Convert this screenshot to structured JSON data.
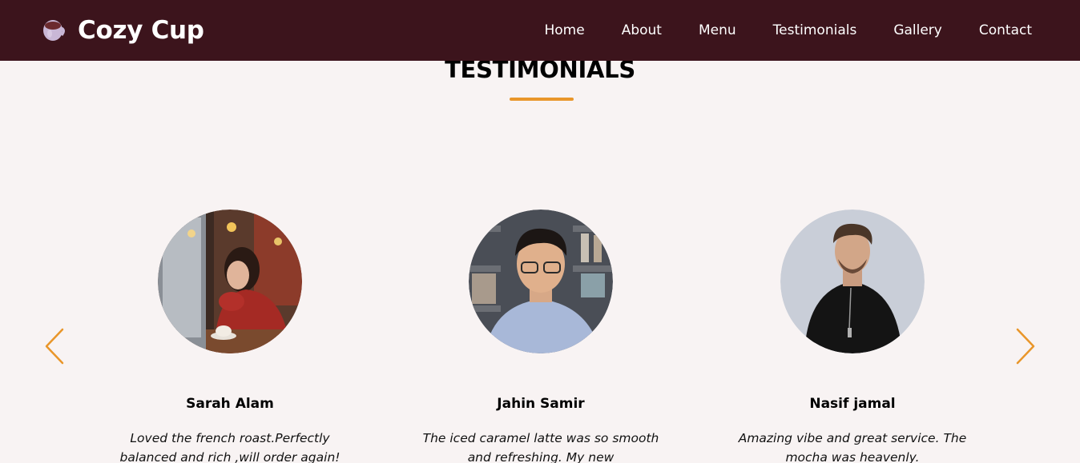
{
  "brand": {
    "name": "Cozy Cup",
    "logo_icon": "coffee-cup-icon"
  },
  "nav": {
    "items": [
      {
        "label": "Home"
      },
      {
        "label": "About"
      },
      {
        "label": "Menu"
      },
      {
        "label": "Testimonials"
      },
      {
        "label": "Gallery"
      },
      {
        "label": "Contact"
      }
    ]
  },
  "section": {
    "title": "TESTIMONIALS",
    "accent_color": "#e9962a"
  },
  "carousel": {
    "prev_icon": "chevron-left-icon",
    "next_icon": "chevron-right-icon"
  },
  "testimonials": [
    {
      "name": "Sarah Alam",
      "quote": "Loved the french roast.Perfectly balanced and rich ,will order again!"
    },
    {
      "name": "Jahin Samir",
      "quote": "The iced caramel latte was so smooth and refreshing. My new"
    },
    {
      "name": "Nasif jamal",
      "quote": "Amazing vibe and great service. The mocha was heavenly."
    }
  ],
  "colors": {
    "navbar_bg": "#3c141c",
    "page_bg": "#f8f3f3",
    "accent": "#e9962a"
  }
}
